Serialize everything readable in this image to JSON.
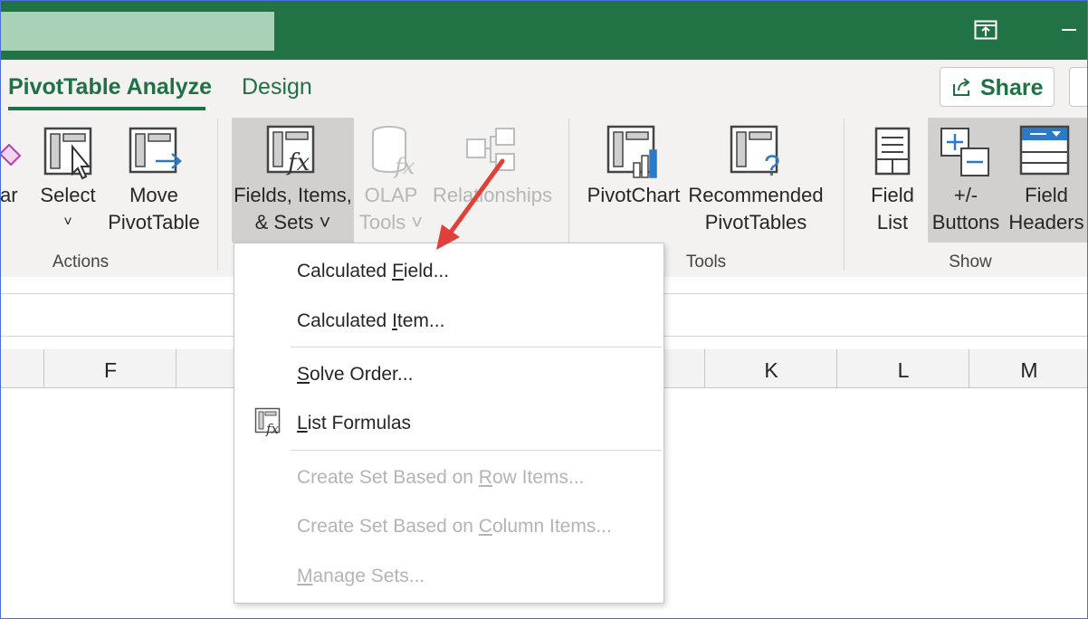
{
  "window": {
    "restore_icon": "restore-window-icon",
    "minimize_icon": "minimize-icon"
  },
  "tabs": {
    "active": "PivotTable Analyze",
    "design": "Design"
  },
  "share": {
    "label": "Share",
    "icon": "share-icon"
  },
  "ribbon": {
    "clear_partial": "ar",
    "select": {
      "line1": "Select",
      "line2": "˅"
    },
    "move": {
      "line1": "Move",
      "line2": "PivotTable"
    },
    "fields": {
      "line1": "Fields, Items,",
      "line2": "& Sets ˅"
    },
    "olap": {
      "line1": "OLAP",
      "line2": "Tools ˅"
    },
    "relationships": {
      "line1": "Relationships"
    },
    "pivotchart": {
      "line1": "PivotChart"
    },
    "recommended": {
      "line1": "Recommended",
      "line2": "PivotTables"
    },
    "field_list": {
      "line1": "Field",
      "line2": "List"
    },
    "plusminus": {
      "line1": "+/-",
      "line2": "Buttons"
    },
    "field_headers": {
      "line1": "Field",
      "line2": "Headers"
    },
    "groups": {
      "actions": "Actions",
      "tools": "Tools",
      "show": "Show"
    }
  },
  "columns": [
    "F",
    "K",
    "L",
    "M"
  ],
  "menu": {
    "calculated_field": {
      "pre": "Calculated ",
      "key": "F",
      "post": "ield..."
    },
    "calculated_item": {
      "pre": "Calculated ",
      "key": "I",
      "post": "tem..."
    },
    "solve_order": {
      "pre": "",
      "key": "S",
      "post": "olve Order..."
    },
    "list_formulas": {
      "pre": "",
      "key": "L",
      "post": "ist Formulas"
    },
    "set_rows": {
      "pre": "Create Set Based on ",
      "key": "R",
      "post": "ow Items..."
    },
    "set_cols": {
      "pre": "Create Set Based on ",
      "key": "C",
      "post": "olumn Items..."
    },
    "manage_sets": {
      "pre": "",
      "key": "M",
      "post": "anage Sets..."
    }
  },
  "colors": {
    "title_bar": "#217346",
    "accent": "#1e7145",
    "arrow": "#e0403a"
  }
}
